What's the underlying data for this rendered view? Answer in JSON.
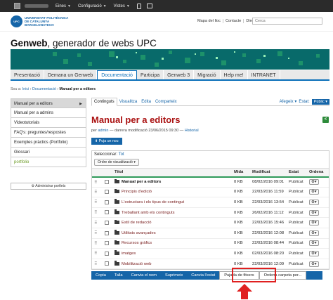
{
  "topbar": {
    "menus": [
      "Eines",
      "Configuració",
      "Vistes"
    ]
  },
  "header": {
    "logo": {
      "seal": "UPC",
      "lines": [
        "UNIVERSITAT POLITÈCNICA",
        "DE CATALUNYA",
        "BARCELONATECH"
      ]
    },
    "links": [
      "Mapa del lloc",
      "Contacte",
      "Directori UPC"
    ],
    "search_placeholder": "Cerca"
  },
  "site": {
    "name_bold": "Genweb",
    "name_rest": ", generador de webs UPC"
  },
  "colors": {
    "accent": "#1565a8",
    "title_red": "#a11111",
    "banner": "#066b6b",
    "highlight": "#e02020"
  },
  "nav": {
    "items": [
      "Presentació",
      "Demana un Genweb",
      "Documentació",
      "Participa",
      "Genweb 3",
      "Migració",
      "Help me!",
      "INTRANET"
    ],
    "active_index": 2
  },
  "breadcrumb": {
    "prefix": "Sou a:",
    "items": [
      "Inici",
      "Documentació",
      "Manual per a editors"
    ]
  },
  "sidebar": {
    "items": [
      "Manual per a editors",
      "Manual per a admins",
      "Videotutorials",
      "FAQ's: preguntes/respostes",
      "Exemples pràctics (Portfolio)",
      "Glossari",
      "portfolio"
    ],
    "admin_button": "Administrar portlets"
  },
  "content": {
    "tabs": [
      "Continguts",
      "Visualitza",
      "Edita",
      "Comparteix"
    ],
    "actions": {
      "add": "Afegeix",
      "state_label": "Estat:",
      "state_value": "Públic"
    },
    "title": "Manual per a editors",
    "meta": {
      "by": "per",
      "author": "admin",
      "modified": "darrera modificació 23/06/2015 09:30",
      "sep": "—",
      "history": "Historial"
    },
    "upload_button": "Puja un nou",
    "select_label": "Seleccionar:",
    "select_all": "Tot",
    "order_button": "Ordre de visualització",
    "columns": [
      "Títol",
      "Mida",
      "Modificat",
      "Estat",
      "Ordena"
    ],
    "rows": [
      {
        "title": "Manual per a editors",
        "size": "0 KB",
        "modified": "08/02/2016 09:01",
        "state": "Publicat"
      },
      {
        "title": "Principis d'edició",
        "size": "0 KB",
        "modified": "22/03/2016 11:59",
        "state": "Publicat"
      },
      {
        "title": "L'estructura i els tipus de contingut",
        "size": "0 KB",
        "modified": "22/03/2016 13:54",
        "state": "Publicat"
      },
      {
        "title": "Treballant amb els continguts",
        "size": "0 KB",
        "modified": "26/02/2016 11:12",
        "state": "Publicat"
      },
      {
        "title": "Estil de redacció",
        "size": "0 KB",
        "modified": "22/03/2016 15:46",
        "state": "Publicat"
      },
      {
        "title": "Utilitats avançades",
        "size": "0 KB",
        "modified": "22/03/2016 12:08",
        "state": "Publicat"
      },
      {
        "title": "Recursos gràfics",
        "size": "0 KB",
        "modified": "22/03/2016 08:44",
        "state": "Publicat"
      },
      {
        "title": "imatges",
        "size": "0 KB",
        "modified": "02/03/2016 08:20",
        "state": "Publicat"
      },
      {
        "title": "Mobilització web",
        "size": "0 KB",
        "modified": "22/03/2016 12:09",
        "state": "Publicat"
      }
    ],
    "bottom_actions": [
      "Copia",
      "Talla",
      "Canvia el nom",
      "Suprimeix",
      "Canvia l'estat",
      "Pujada de fitxers",
      "Ordena carpeta per..."
    ]
  }
}
